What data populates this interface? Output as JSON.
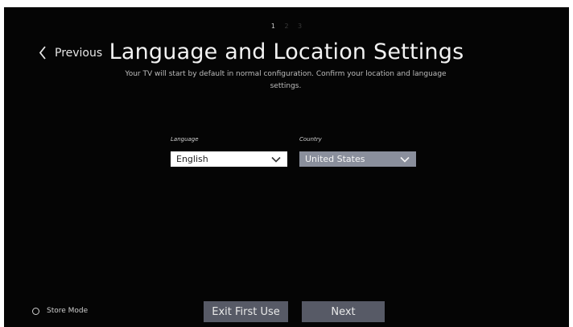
{
  "steps": {
    "items": [
      "1",
      "2",
      "3"
    ],
    "active": "1"
  },
  "nav": {
    "previous_label": "Previous"
  },
  "header": {
    "title": "Language and Location Settings",
    "subtitle": "Your TV will start by default in normal configuration. Confirm your location and language settings."
  },
  "form": {
    "language": {
      "label": "Language",
      "value": "English"
    },
    "country": {
      "label": "Country",
      "value": "United States"
    }
  },
  "footer": {
    "store_mode_label": "Store Mode",
    "store_mode_selected": false,
    "exit_label": "Exit First Use",
    "next_label": "Next"
  },
  "colors": {
    "background": "#050505",
    "button": "#575a66",
    "country_select": "#8a8f9c",
    "language_select": "#ffffff"
  },
  "icons": [
    "chevron-left-icon",
    "chevron-down-icon",
    "radio-icon"
  ]
}
